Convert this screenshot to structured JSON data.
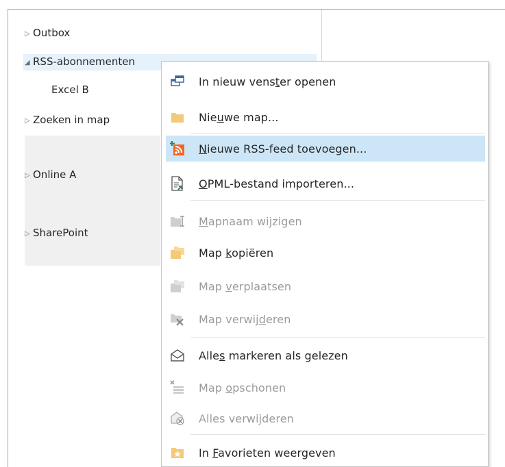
{
  "folders": [
    {
      "label": "Outbox",
      "expander": "collapsed"
    },
    {
      "label": "RSS-abonnementen",
      "expander": "expanded"
    },
    {
      "label": "Excel B",
      "expander": "none"
    },
    {
      "label": "Zoeken in map",
      "expander": "collapsed"
    },
    {
      "label": "Online A",
      "expander": "collapsed"
    },
    {
      "label": "SharePoint",
      "expander": "collapsed"
    }
  ],
  "menu": {
    "items": [
      {
        "pre": "In nieuw vens",
        "key": "t",
        "post": "er openen",
        "icon": "new-window-icon",
        "enabled": true,
        "highlighted": false
      },
      {
        "pre": "Nie",
        "key": "u",
        "post": "we map...",
        "icon": "folder-icon",
        "enabled": true,
        "highlighted": false
      },
      {
        "pre": "",
        "key": "N",
        "post": "ieuwe RSS-feed toevoegen...",
        "icon": "rss-add-icon",
        "enabled": true,
        "highlighted": true
      },
      {
        "pre": "",
        "key": "O",
        "post": "PML-bestand importeren...",
        "icon": "import-file-icon",
        "enabled": true,
        "highlighted": false
      },
      {
        "pre": "",
        "key": "M",
        "post": "apnaam wijzigen",
        "icon": "rename-folder-icon",
        "enabled": false,
        "highlighted": false
      },
      {
        "pre": "Map ",
        "key": "k",
        "post": "opiëren",
        "icon": "copy-folder-icon",
        "enabled": true,
        "highlighted": false
      },
      {
        "pre": "Map ",
        "key": "v",
        "post": "erplaatsen",
        "icon": "move-folder-icon",
        "enabled": false,
        "highlighted": false
      },
      {
        "pre": "Map verwij",
        "key": "d",
        "post": "eren",
        "icon": "delete-folder-icon",
        "enabled": false,
        "highlighted": false
      },
      {
        "pre": "Alle",
        "key": "s",
        "post": " markeren als gelezen",
        "icon": "mark-read-icon",
        "enabled": true,
        "highlighted": false
      },
      {
        "pre": "Map ",
        "key": "o",
        "post": "pschonen",
        "icon": "cleanup-icon",
        "enabled": false,
        "highlighted": false
      },
      {
        "pre": "Alles verwijderen",
        "key": "",
        "post": "",
        "icon": "delete-all-icon",
        "enabled": false,
        "highlighted": false
      },
      {
        "pre": "In ",
        "key": "F",
        "post": "avorieten weergeven",
        "icon": "favorites-icon",
        "enabled": true,
        "highlighted": false
      }
    ]
  },
  "colors": {
    "highlight": "#cde6f7",
    "folder": "#f3c97a",
    "rss": "#f26522",
    "disabled": "#9b9b9b",
    "text": "#262626"
  }
}
